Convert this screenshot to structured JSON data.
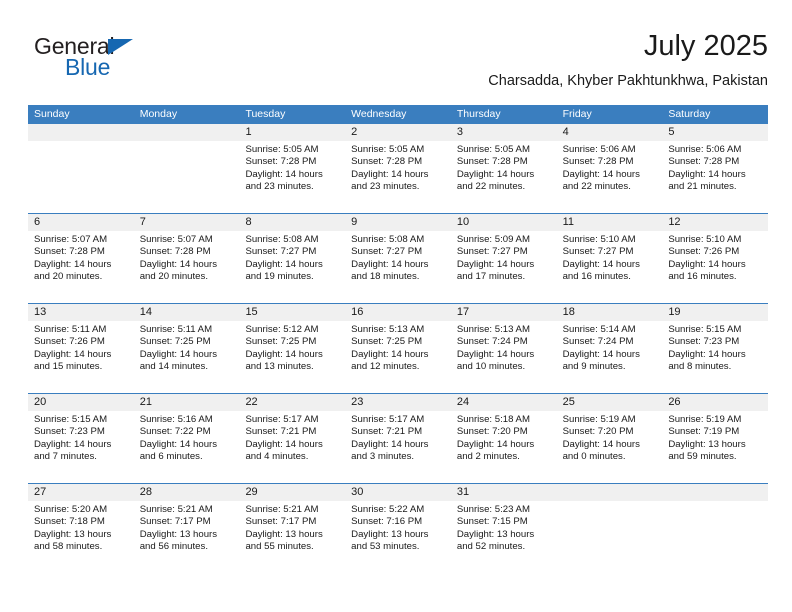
{
  "brand": {
    "name_part1": "General",
    "name_part2": "Blue",
    "triangle_color": "#1667b1",
    "accent_color": "#1667b1"
  },
  "header": {
    "title": "July 2025",
    "location": "Charsadda, Khyber Pakhtunkhwa, Pakistan"
  },
  "calendar": {
    "header_bg": "#3a7ebf",
    "date_band_bg": "#f0f0f0",
    "weekdays": [
      "Sunday",
      "Monday",
      "Tuesday",
      "Wednesday",
      "Thursday",
      "Friday",
      "Saturday"
    ],
    "weeks": [
      {
        "days": [
          {
            "num": "",
            "lines": []
          },
          {
            "num": "",
            "lines": []
          },
          {
            "num": "1",
            "lines": [
              "Sunrise: 5:05 AM",
              "Sunset: 7:28 PM",
              "Daylight: 14 hours",
              "and 23 minutes."
            ]
          },
          {
            "num": "2",
            "lines": [
              "Sunrise: 5:05 AM",
              "Sunset: 7:28 PM",
              "Daylight: 14 hours",
              "and 23 minutes."
            ]
          },
          {
            "num": "3",
            "lines": [
              "Sunrise: 5:05 AM",
              "Sunset: 7:28 PM",
              "Daylight: 14 hours",
              "and 22 minutes."
            ]
          },
          {
            "num": "4",
            "lines": [
              "Sunrise: 5:06 AM",
              "Sunset: 7:28 PM",
              "Daylight: 14 hours",
              "and 22 minutes."
            ]
          },
          {
            "num": "5",
            "lines": [
              "Sunrise: 5:06 AM",
              "Sunset: 7:28 PM",
              "Daylight: 14 hours",
              "and 21 minutes."
            ]
          }
        ]
      },
      {
        "days": [
          {
            "num": "6",
            "lines": [
              "Sunrise: 5:07 AM",
              "Sunset: 7:28 PM",
              "Daylight: 14 hours",
              "and 20 minutes."
            ]
          },
          {
            "num": "7",
            "lines": [
              "Sunrise: 5:07 AM",
              "Sunset: 7:28 PM",
              "Daylight: 14 hours",
              "and 20 minutes."
            ]
          },
          {
            "num": "8",
            "lines": [
              "Sunrise: 5:08 AM",
              "Sunset: 7:27 PM",
              "Daylight: 14 hours",
              "and 19 minutes."
            ]
          },
          {
            "num": "9",
            "lines": [
              "Sunrise: 5:08 AM",
              "Sunset: 7:27 PM",
              "Daylight: 14 hours",
              "and 18 minutes."
            ]
          },
          {
            "num": "10",
            "lines": [
              "Sunrise: 5:09 AM",
              "Sunset: 7:27 PM",
              "Daylight: 14 hours",
              "and 17 minutes."
            ]
          },
          {
            "num": "11",
            "lines": [
              "Sunrise: 5:10 AM",
              "Sunset: 7:27 PM",
              "Daylight: 14 hours",
              "and 16 minutes."
            ]
          },
          {
            "num": "12",
            "lines": [
              "Sunrise: 5:10 AM",
              "Sunset: 7:26 PM",
              "Daylight: 14 hours",
              "and 16 minutes."
            ]
          }
        ]
      },
      {
        "days": [
          {
            "num": "13",
            "lines": [
              "Sunrise: 5:11 AM",
              "Sunset: 7:26 PM",
              "Daylight: 14 hours",
              "and 15 minutes."
            ]
          },
          {
            "num": "14",
            "lines": [
              "Sunrise: 5:11 AM",
              "Sunset: 7:25 PM",
              "Daylight: 14 hours",
              "and 14 minutes."
            ]
          },
          {
            "num": "15",
            "lines": [
              "Sunrise: 5:12 AM",
              "Sunset: 7:25 PM",
              "Daylight: 14 hours",
              "and 13 minutes."
            ]
          },
          {
            "num": "16",
            "lines": [
              "Sunrise: 5:13 AM",
              "Sunset: 7:25 PM",
              "Daylight: 14 hours",
              "and 12 minutes."
            ]
          },
          {
            "num": "17",
            "lines": [
              "Sunrise: 5:13 AM",
              "Sunset: 7:24 PM",
              "Daylight: 14 hours",
              "and 10 minutes."
            ]
          },
          {
            "num": "18",
            "lines": [
              "Sunrise: 5:14 AM",
              "Sunset: 7:24 PM",
              "Daylight: 14 hours",
              "and 9 minutes."
            ]
          },
          {
            "num": "19",
            "lines": [
              "Sunrise: 5:15 AM",
              "Sunset: 7:23 PM",
              "Daylight: 14 hours",
              "and 8 minutes."
            ]
          }
        ]
      },
      {
        "days": [
          {
            "num": "20",
            "lines": [
              "Sunrise: 5:15 AM",
              "Sunset: 7:23 PM",
              "Daylight: 14 hours",
              "and 7 minutes."
            ]
          },
          {
            "num": "21",
            "lines": [
              "Sunrise: 5:16 AM",
              "Sunset: 7:22 PM",
              "Daylight: 14 hours",
              "and 6 minutes."
            ]
          },
          {
            "num": "22",
            "lines": [
              "Sunrise: 5:17 AM",
              "Sunset: 7:21 PM",
              "Daylight: 14 hours",
              "and 4 minutes."
            ]
          },
          {
            "num": "23",
            "lines": [
              "Sunrise: 5:17 AM",
              "Sunset: 7:21 PM",
              "Daylight: 14 hours",
              "and 3 minutes."
            ]
          },
          {
            "num": "24",
            "lines": [
              "Sunrise: 5:18 AM",
              "Sunset: 7:20 PM",
              "Daylight: 14 hours",
              "and 2 minutes."
            ]
          },
          {
            "num": "25",
            "lines": [
              "Sunrise: 5:19 AM",
              "Sunset: 7:20 PM",
              "Daylight: 14 hours",
              "and 0 minutes."
            ]
          },
          {
            "num": "26",
            "lines": [
              "Sunrise: 5:19 AM",
              "Sunset: 7:19 PM",
              "Daylight: 13 hours",
              "and 59 minutes."
            ]
          }
        ]
      },
      {
        "days": [
          {
            "num": "27",
            "lines": [
              "Sunrise: 5:20 AM",
              "Sunset: 7:18 PM",
              "Daylight: 13 hours",
              "and 58 minutes."
            ]
          },
          {
            "num": "28",
            "lines": [
              "Sunrise: 5:21 AM",
              "Sunset: 7:17 PM",
              "Daylight: 13 hours",
              "and 56 minutes."
            ]
          },
          {
            "num": "29",
            "lines": [
              "Sunrise: 5:21 AM",
              "Sunset: 7:17 PM",
              "Daylight: 13 hours",
              "and 55 minutes."
            ]
          },
          {
            "num": "30",
            "lines": [
              "Sunrise: 5:22 AM",
              "Sunset: 7:16 PM",
              "Daylight: 13 hours",
              "and 53 minutes."
            ]
          },
          {
            "num": "31",
            "lines": [
              "Sunrise: 5:23 AM",
              "Sunset: 7:15 PM",
              "Daylight: 13 hours",
              "and 52 minutes."
            ]
          },
          {
            "num": "",
            "lines": []
          },
          {
            "num": "",
            "lines": []
          }
        ]
      }
    ]
  }
}
